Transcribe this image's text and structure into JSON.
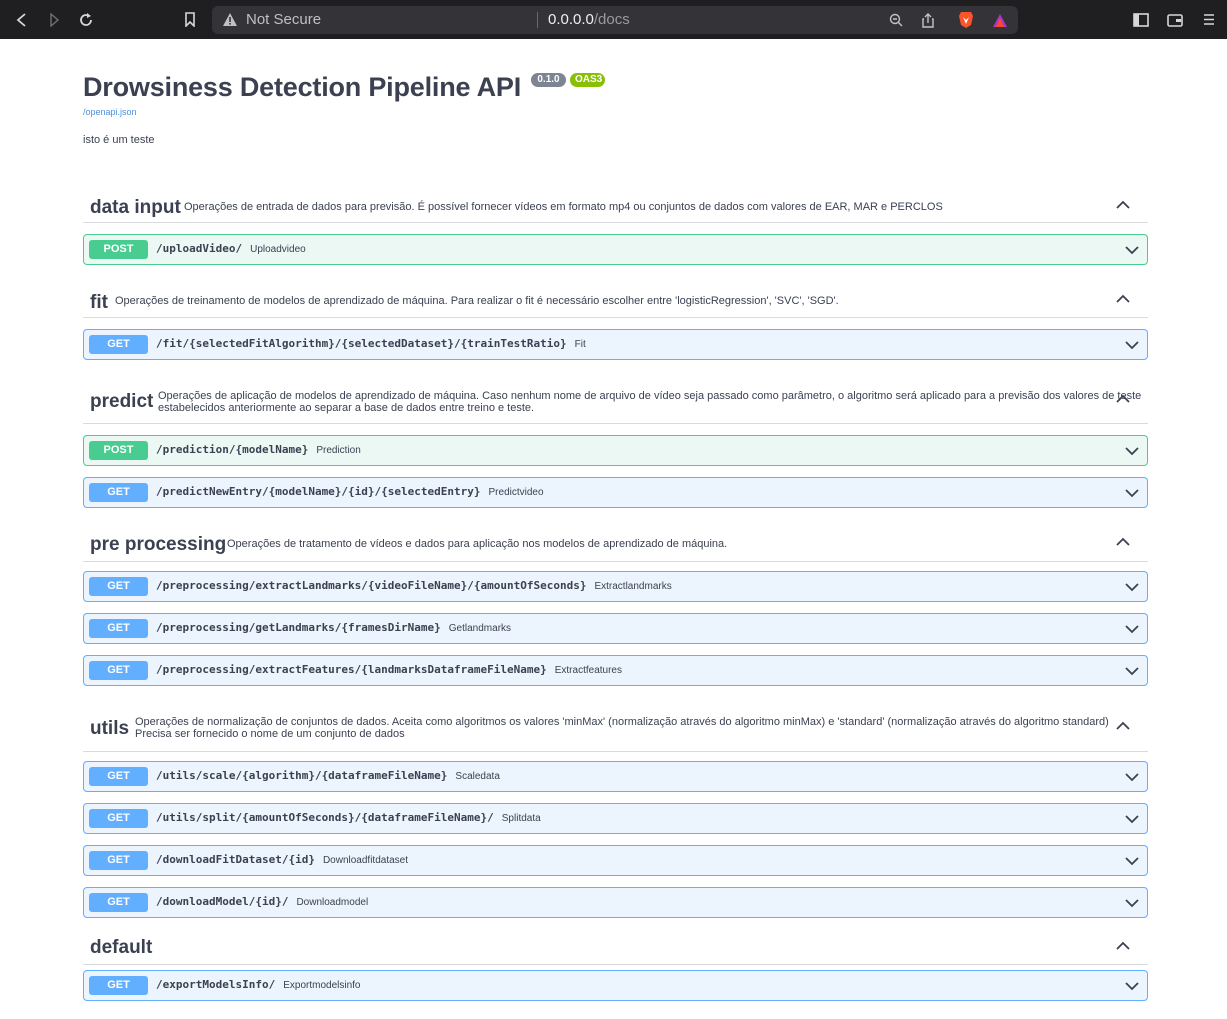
{
  "browser": {
    "not_secure": "Not Secure",
    "url_host": "0.0.0.0",
    "url_path": "/docs"
  },
  "api": {
    "title": "Drowsiness Detection Pipeline API",
    "version": "0.1.0",
    "oas": "OAS3",
    "openapi_link": "/openapi.json",
    "description": "isto é um teste"
  },
  "tags": [
    {
      "name": "data input",
      "description": "Operações de entrada de dados para previsão. É possível fornecer vídeos em formato mp4 ou conjuntos de dados com valores de EAR, MAR e PERCLOS",
      "description_2": "",
      "operations": [
        {
          "method": "POST",
          "path": "/uploadVideo/",
          "summary": "Uploadvideo"
        }
      ]
    },
    {
      "name": "fit",
      "description": "Operações de treinamento de modelos de aprendizado de máquina. Para realizar o fit é necessário escolher entre 'logisticRegression', 'SVC', 'SGD'.",
      "description_2": "",
      "operations": [
        {
          "method": "GET",
          "path": "/fit/{selectedFitAlgorithm}/{selectedDataset}/{trainTestRatio}",
          "summary": "Fit"
        }
      ]
    },
    {
      "name": "predict",
      "description": "Operações de aplicação de modelos de aprendizado de máquina. Caso nenhum nome de arquivo de vídeo seja passado como parâmetro, o algoritmo será aplicado para a previsão dos valores de teste",
      "description_2": "estabelecidos anteriormente ao separar a base de dados entre treino e teste.",
      "operations": [
        {
          "method": "POST",
          "path": "/prediction/{modelName}",
          "summary": "Prediction"
        },
        {
          "method": "GET",
          "path": "/predictNewEntry/{modelName}/{id}/{selectedEntry}",
          "summary": "Predictvideo"
        }
      ]
    },
    {
      "name": "pre processing",
      "description": "Operações de tratamento de vídeos e dados para aplicação nos modelos de aprendizado de máquina.",
      "description_2": "",
      "operations": [
        {
          "method": "GET",
          "path": "/preprocessing/extractLandmarks/{videoFileName}/{amountOfSeconds}",
          "summary": "Extractlandmarks"
        },
        {
          "method": "GET",
          "path": "/preprocessing/getLandmarks/{framesDirName}",
          "summary": "Getlandmarks"
        },
        {
          "method": "GET",
          "path": "/preprocessing/extractFeatures/{landmarksDataframeFileName}",
          "summary": "Extractfeatures"
        }
      ]
    },
    {
      "name": "utils",
      "description": "Operações de normalização de conjuntos de dados. Aceita como algoritmos os valores 'minMax' (normalização através do algoritmo minMax) e 'standard' (normalização através do algoritmo standard)",
      "description_2": "Precisa ser fornecido o nome de um conjunto de dados",
      "operations": [
        {
          "method": "GET",
          "path": "/utils/scale/{algorithm}/{dataframeFileName}",
          "summary": "Scaledata"
        },
        {
          "method": "GET",
          "path": "/utils/split/{amountOfSeconds}/{dataframeFileName}/",
          "summary": "Splitdata"
        },
        {
          "method": "GET",
          "path": "/downloadFitDataset/{id}",
          "summary": "Downloadfitdataset"
        },
        {
          "method": "GET",
          "path": "/downloadModel/{id}/",
          "summary": "Downloadmodel"
        }
      ]
    },
    {
      "name": "default",
      "description": "",
      "description_2": "",
      "operations": [
        {
          "method": "GET",
          "path": "/exportModelsInfo/",
          "summary": "Exportmodelsinfo"
        }
      ]
    }
  ]
}
